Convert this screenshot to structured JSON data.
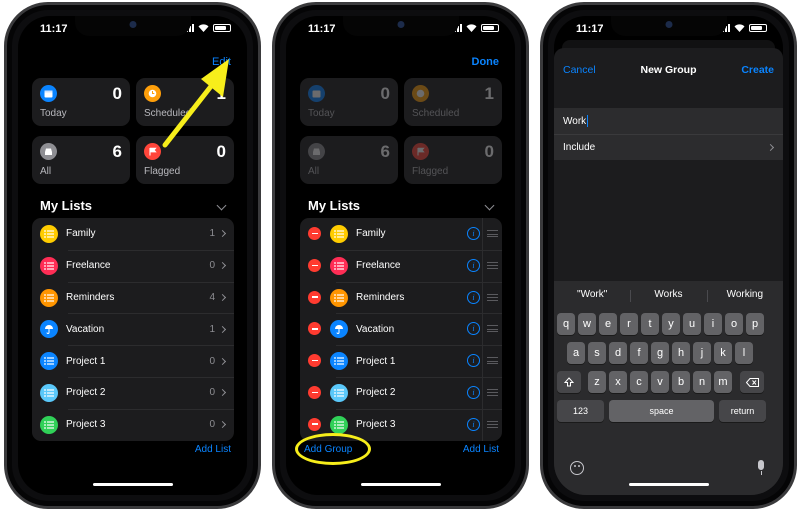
{
  "status_time": "11:17",
  "colors": {
    "accent": "#0a84ff",
    "annotation": "#f7ee1b",
    "delete": "#ff3b30",
    "today": "#0a84ff",
    "scheduled": "#ff9f0a",
    "all": "#8e8e93",
    "flagged": "#ff453a"
  },
  "summary_cards": [
    {
      "label": "Today",
      "count": "0",
      "icon": "calendar-icon",
      "color": "#0a84ff"
    },
    {
      "label": "Scheduled",
      "count": "1",
      "icon": "clock-icon",
      "color": "#ff9f0a"
    },
    {
      "label": "All",
      "count": "6",
      "icon": "tray-icon",
      "color": "#8e8e93"
    },
    {
      "label": "Flagged",
      "count": "0",
      "icon": "flag-icon",
      "color": "#ff453a"
    }
  ],
  "my_lists_title": "My Lists",
  "lists": [
    {
      "name": "Family",
      "count": "1",
      "color": "#ffcc00",
      "icon": "list-icon"
    },
    {
      "name": "Freelance",
      "count": "0",
      "color": "#ff2d55",
      "icon": "list-icon"
    },
    {
      "name": "Reminders",
      "count": "4",
      "color": "#ff9500",
      "icon": "list-icon"
    },
    {
      "name": "Vacation",
      "count": "1",
      "color": "#0a84ff",
      "icon": "umbrella-icon"
    },
    {
      "name": "Project 1",
      "count": "0",
      "color": "#0a84ff",
      "icon": "list-icon"
    },
    {
      "name": "Project 2",
      "count": "0",
      "color": "#5ac8fa",
      "icon": "list-icon"
    },
    {
      "name": "Project 3",
      "count": "0",
      "color": "#30d158",
      "icon": "list-icon"
    }
  ],
  "phone1": {
    "edit_label": "Edit",
    "add_list_label": "Add List"
  },
  "phone2": {
    "done_label": "Done",
    "add_group_label": "Add Group",
    "add_list_label": "Add List",
    "info_glyph": "i"
  },
  "phone3": {
    "cancel_label": "Cancel",
    "title": "New Group",
    "create_label": "Create",
    "name_value": "Work",
    "include_label": "Include",
    "suggestions": [
      "\"Work\"",
      "Works",
      "Working"
    ],
    "keyboard": {
      "row1": [
        "q",
        "w",
        "e",
        "r",
        "t",
        "y",
        "u",
        "i",
        "o",
        "p"
      ],
      "row2": [
        "a",
        "s",
        "d",
        "f",
        "g",
        "h",
        "j",
        "k",
        "l"
      ],
      "row3": [
        "z",
        "x",
        "c",
        "v",
        "b",
        "n",
        "m"
      ],
      "numbers_key": "123",
      "space_key": "space",
      "return_key": "return"
    }
  }
}
